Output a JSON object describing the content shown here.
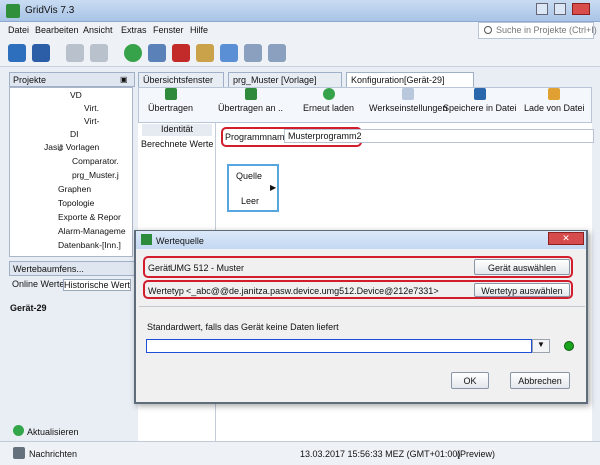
{
  "window": {
    "title": "GridVis 7.3"
  },
  "menu": [
    "Datei",
    "Bearbeiten",
    "Ansicht",
    "Extras",
    "Fenster",
    "Hilfe"
  ],
  "search": {
    "placeholder": "Suche in Projekte (Ctrl+I)"
  },
  "toolbar_icons": [
    "floppy-disks-icon",
    "save-all-icon",
    "undo-icon",
    "redo-icon",
    "refresh-icon",
    "db-icon",
    "import-icon",
    "tools-icon",
    "users-icon",
    "module-icon",
    "grid-icon"
  ],
  "projects": {
    "title": "Projekte",
    "tree": [
      "VD",
      "Virt.",
      "Virt-",
      "DI",
      "Jasic Vorlagen",
      "Comparator.",
      "prg_Muster.j",
      "Graphen",
      "Topologie",
      "Exporte & Repor",
      "Alarm-Manageme",
      "Datenbank-[Inn.]"
    ]
  },
  "values_tree": {
    "title": "Wertebaumfens...",
    "tab_online": "Online Werte",
    "tab_historic": "Historische Werte",
    "device": "Gerät-29",
    "refresh": "Aktualisieren"
  },
  "editor": {
    "tabs": [
      "Übersichtsfenster",
      "prg_Muster [Vorlage]",
      "Konfiguration[Gerät-29]"
    ],
    "actions": [
      "Übertragen",
      "Übertragen an ..",
      "Erneut laden",
      "Werkseinstellungen",
      "Speichere in Datei",
      "Lade von Datei"
    ],
    "side_tabs": [
      "Identität",
      "Berechnete Werte"
    ],
    "program_label": "Programmname",
    "program_value": "Musterprogramm2",
    "node_source": "Quelle",
    "node_empty": "Leer"
  },
  "dialog": {
    "title": "Wertequelle",
    "device_label": "Gerät",
    "device_value": "UMG 512 - Muster",
    "device_button": "Gerät auswählen",
    "valuetype_label": "Wertetyp",
    "valuetype_value": "<_abc@@de.janitza.pasw.device.umg512.Device@212e7331>",
    "valuetype_button": "Wertetyp auswählen",
    "default_hint": "Standardwert, falls das Gerät keine Daten liefert",
    "ok": "OK",
    "cancel": "Abbrechen"
  },
  "status": {
    "messages": "Nachrichten",
    "timestamp": "13.03.2017 15:56:33 MEZ (GMT+01:00)",
    "mode": "(Preview)"
  }
}
